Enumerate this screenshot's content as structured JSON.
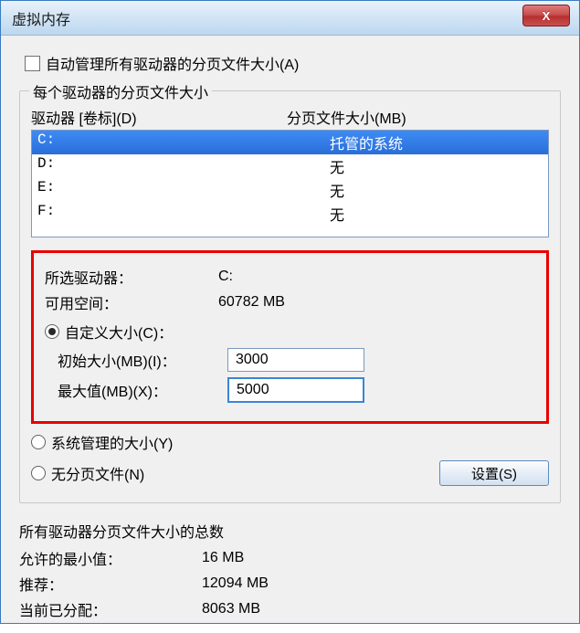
{
  "window": {
    "title": "虚拟内存",
    "close_glyph": "X"
  },
  "auto_manage": {
    "checked": false,
    "label": "自动管理所有驱动器的分页文件大小(A)"
  },
  "drives_section": {
    "legend": "每个驱动器的分页文件大小",
    "header_drive": "驱动器 [卷标](D)",
    "header_paging": "分页文件大小(MB)",
    "rows": [
      {
        "drive": "C:",
        "paging": "托管的系统",
        "selected": true
      },
      {
        "drive": "D:",
        "paging": "无",
        "selected": false
      },
      {
        "drive": "E:",
        "paging": "无",
        "selected": false
      },
      {
        "drive": "F:",
        "paging": "无",
        "selected": false
      }
    ]
  },
  "selected": {
    "drive_label": "所选驱动器：",
    "drive_value": "C:",
    "space_label": "可用空间：",
    "space_value": "60782 MB",
    "custom_radio_label": "自定义大小(C)：",
    "initial_label": "初始大小(MB)(I)：",
    "initial_value": "3000",
    "max_label": "最大值(MB)(X)：",
    "max_value": "5000"
  },
  "other_radios": {
    "system_managed": "系统管理的大小(Y)",
    "no_paging": "无分页文件(N)"
  },
  "set_button": "设置(S)",
  "totals": {
    "heading": "所有驱动器分页文件大小的总数",
    "min_label": "允许的最小值：",
    "min_value": "16 MB",
    "rec_label": "推荐：",
    "rec_value": "12094 MB",
    "cur_label": "当前已分配：",
    "cur_value": "8063 MB"
  }
}
